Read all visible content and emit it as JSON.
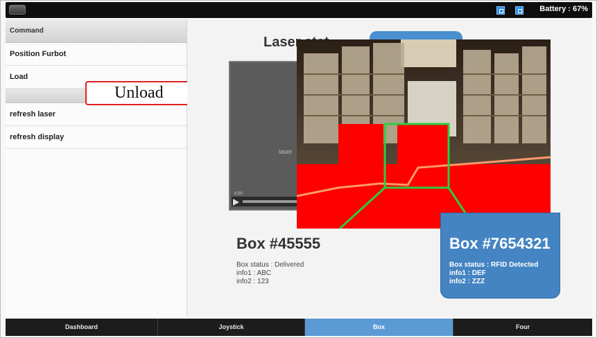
{
  "topbar": {
    "battery": "Battery : 67%"
  },
  "sidebar": {
    "header": "Command",
    "items": [
      {
        "label": "Position Furbot"
      },
      {
        "label": "Load"
      }
    ],
    "items2": [
      {
        "label": "refresh laser"
      },
      {
        "label": "refresh display"
      }
    ]
  },
  "annotation": {
    "unload": "Unload"
  },
  "main": {
    "laser_title": "Laser stat"
  },
  "box1": {
    "title": "Box #45555",
    "status": "Box status : Delivered",
    "info1": "info1 : ABC",
    "info2": "info2 : 123"
  },
  "box2": {
    "title": "Box #7654321",
    "status": "Box status : RFID Detected",
    "info1": "info1 : DEF",
    "info2": "info2 : ZZZ"
  },
  "tabs": [
    {
      "label": "Dashboard"
    },
    {
      "label": "Joystick"
    },
    {
      "label": "Box",
      "active": true
    },
    {
      "label": "Four"
    }
  ],
  "colors": {
    "accent": "#5b9bd5",
    "detection_overlay": "#ff0000",
    "guide_lines": "#2ecc40",
    "annotation_border": "#e02020"
  }
}
